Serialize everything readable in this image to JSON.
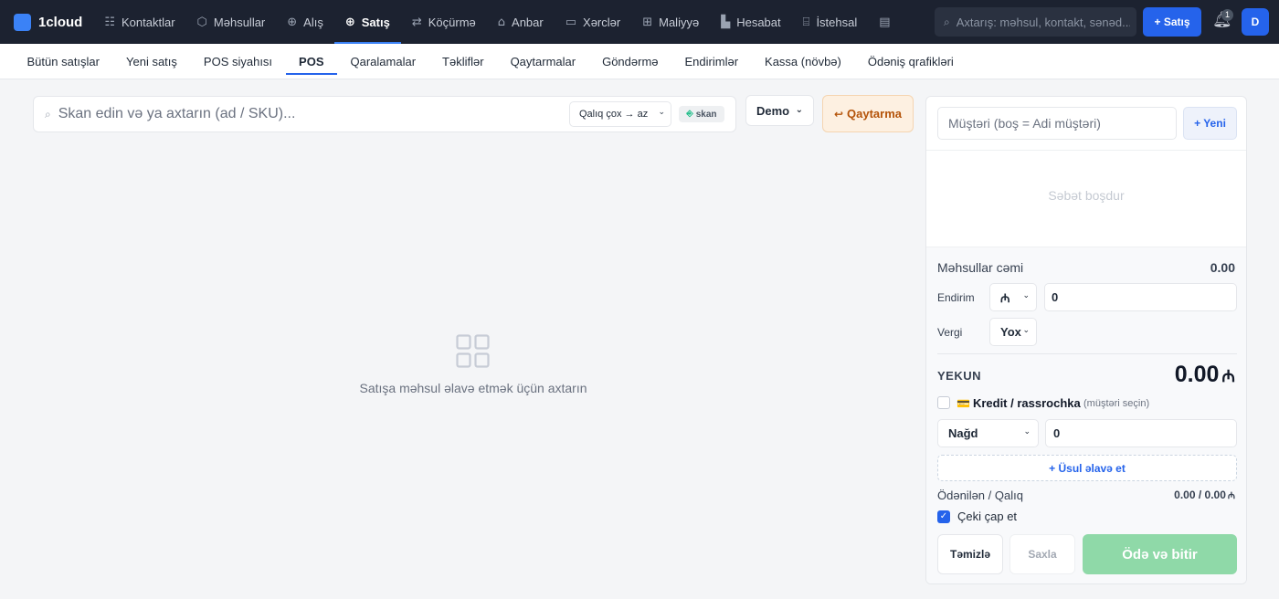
{
  "app": {
    "name": "1cloud"
  },
  "topnav": {
    "items": [
      {
        "label": "Kontaktlar",
        "icon": "contacts-icon",
        "glyph": "☷"
      },
      {
        "label": "Məhsullar",
        "icon": "box-icon",
        "glyph": "⬡"
      },
      {
        "label": "Alış",
        "icon": "purchase-icon",
        "glyph": "⊕"
      },
      {
        "label": "Satış",
        "icon": "sales-icon",
        "glyph": "⊕",
        "active": true
      },
      {
        "label": "Köçürmə",
        "icon": "transfer-icon",
        "glyph": "⇄"
      },
      {
        "label": "Anbar",
        "icon": "warehouse-icon",
        "glyph": "⌂"
      },
      {
        "label": "Xərclər",
        "icon": "expenses-icon",
        "glyph": "▭"
      },
      {
        "label": "Maliyyə",
        "icon": "finance-icon",
        "glyph": "⊞"
      },
      {
        "label": "Hesabat",
        "icon": "report-icon",
        "glyph": "▙"
      },
      {
        "label": "İstehsal",
        "icon": "production-icon",
        "glyph": "⌸"
      },
      {
        "label": "",
        "icon": "document-icon",
        "glyph": "▤"
      }
    ],
    "search_placeholder": "Axtarış: məhsul, kontakt, sənəd...",
    "new_sale_label": "+ Satış",
    "notification_count": "1",
    "avatar_initial": "D"
  },
  "subnav": {
    "items": [
      {
        "label": "Bütün satışlar"
      },
      {
        "label": "Yeni satış"
      },
      {
        "label": "POS siyahısı"
      },
      {
        "label": "POS",
        "active": true
      },
      {
        "label": "Qaralamalar"
      },
      {
        "label": "Təkliflər"
      },
      {
        "label": "Qaytarmalar"
      },
      {
        "label": "Göndərmə"
      },
      {
        "label": "Endirimlər"
      },
      {
        "label": "Kassa (növbə)"
      },
      {
        "label": "Ödəniş qrafikləri"
      }
    ]
  },
  "pos": {
    "search_placeholder": "Skan edin və ya axtarın (ad / SKU)...",
    "sort_value": "Qalıq çox → az",
    "scan_label": "skan",
    "warehouse_value": "Demo",
    "return_label": "Qaytarma",
    "empty_message": "Satışa məhsul əlavə etmək üçün axtarın"
  },
  "cart": {
    "customer_placeholder": "Müştəri (boş = Adi müştəri)",
    "new_customer_label": "+ Yeni",
    "empty_message": "Səbət boşdur",
    "subtotal_label": "Məhsullar cəmi",
    "subtotal_value": "0.00",
    "discount_label": "Endirim",
    "discount_type": "₼",
    "discount_value": "0",
    "tax_label": "Vergi",
    "tax_value": "Yox",
    "total_label": "YEKUN",
    "total_value": "0.00",
    "currency_symbol": "₼",
    "credit_icon": "💳",
    "credit_label": "Kredit / rassrochka",
    "credit_hint": "(müştəri seçin)",
    "payment_method": "Nağd",
    "payment_amount": "0",
    "add_method_label": "+ Üsul əlavə et",
    "paid_label": "Ödənilən / Qalıq",
    "paid_value": "0.00 / 0.00",
    "print_label": "Çeki çap et",
    "print_checked": true,
    "clear_label": "Təmizlə",
    "save_label": "Saxla",
    "pay_label": "Ödə və bitir"
  },
  "colors": {
    "topbar_bg": "#1c2230",
    "accent": "#2563eb",
    "pay_button": "#8fd9a8",
    "return_button_bg": "#fdf0e1"
  }
}
